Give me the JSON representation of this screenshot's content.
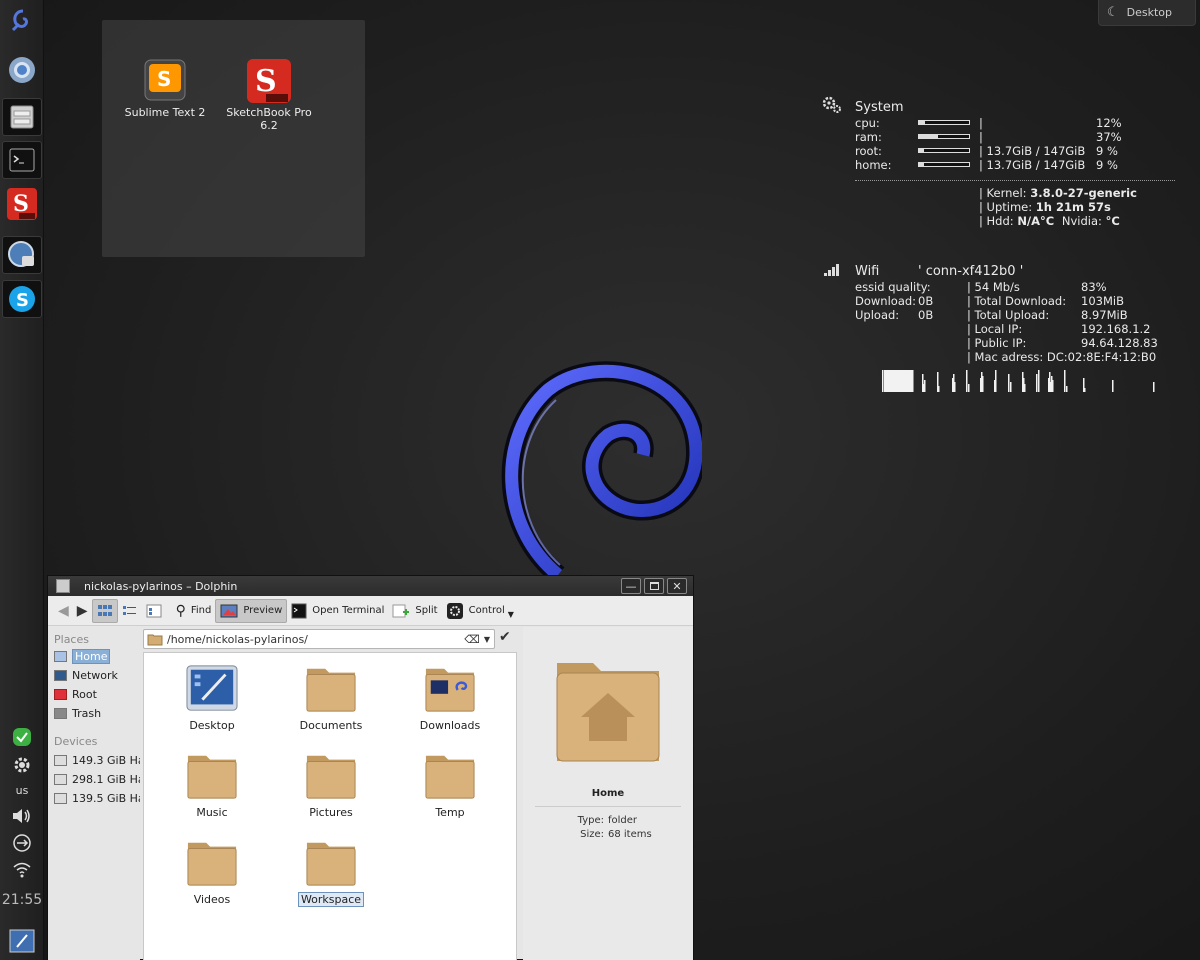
{
  "desktop": {
    "button_label": "Desktop",
    "icons": [
      {
        "name": "sublime-text",
        "label": "Sublime Text 2"
      },
      {
        "name": "sketchbook-pro",
        "label": "SketchBook Pro 6.2"
      }
    ]
  },
  "panel": {
    "launchers": [
      "debian-swirl",
      "chromium",
      "file-manager",
      "terminal",
      "sketchbook-pro",
      "system-settings",
      "skype"
    ],
    "tray": {
      "keyboard_layout": "us",
      "clock": "21:55"
    }
  },
  "conky_system": {
    "title": "System",
    "rows": [
      {
        "label": "cpu:",
        "sep": "|",
        "value": "12%",
        "level": 0.12
      },
      {
        "label": "ram:",
        "sep": "|",
        "value": "37%",
        "level": 0.37
      },
      {
        "label": "root:",
        "sep": "| 13.7GiB / 147GiB",
        "value": "9 %",
        "level": 0.09
      },
      {
        "label": "home:",
        "sep": "| 13.7GiB / 147GiB",
        "value": "9 %",
        "level": 0.09
      }
    ],
    "kernel_label": "| Kernel:",
    "kernel_value": "3.8.0-27-generic",
    "uptime_label": "| Uptime:",
    "uptime_value": "1h 21m 57s",
    "hdd_label": "| Hdd:",
    "hdd_value": "N/A°C",
    "nvidia_label": "Nvidia:",
    "nvidia_value": "°C"
  },
  "conky_wifi": {
    "title": "Wifi",
    "ssid": "' conn-xf412b0 '",
    "essid_label": "essid quality:",
    "download_label": "Download:",
    "download_value": "0B",
    "upload_label": "Upload:",
    "upload_value": "0B",
    "rows": [
      {
        "label": "| 54 Mb/s",
        "value": "83%"
      },
      {
        "label": "| Total Download:",
        "value": "103MiB"
      },
      {
        "label": "| Total Upload:",
        "value": "8.97MiB"
      },
      {
        "label": "| Local IP:",
        "value": "192.168.1.2"
      },
      {
        "label": "| Public IP:",
        "value": "94.64.128.83"
      },
      {
        "label": "| Mac adress:",
        "value": "DC:02:8E:F4:12:B0"
      }
    ]
  },
  "dolphin": {
    "title": "nickolas-pylarinos – Dolphin",
    "toolbar": {
      "find": "Find",
      "preview": "Preview",
      "open_terminal": "Open Terminal",
      "split": "Split",
      "control": "Control"
    },
    "places_header": "Places",
    "places": [
      "Home",
      "Network",
      "Root",
      "Trash"
    ],
    "devices_header": "Devices",
    "devices": [
      "149.3 GiB Ha",
      "298.1 GiB Ha",
      "139.5 GiB Ha"
    ],
    "path": "/home/nickolas-pylarinos/",
    "files": [
      "Desktop",
      "Documents",
      "Downloads",
      "Music",
      "Pictures",
      "Temp",
      "Videos",
      "Workspace"
    ],
    "preview": {
      "name": "Home",
      "type_label": "Type:",
      "type_value": "folder",
      "size_label": "Size:",
      "size_value": "68 items"
    }
  },
  "colors": {
    "folder": "#d2ac72",
    "selection": "#8ab0d8",
    "debian_swirl": "#2a3fd8"
  }
}
